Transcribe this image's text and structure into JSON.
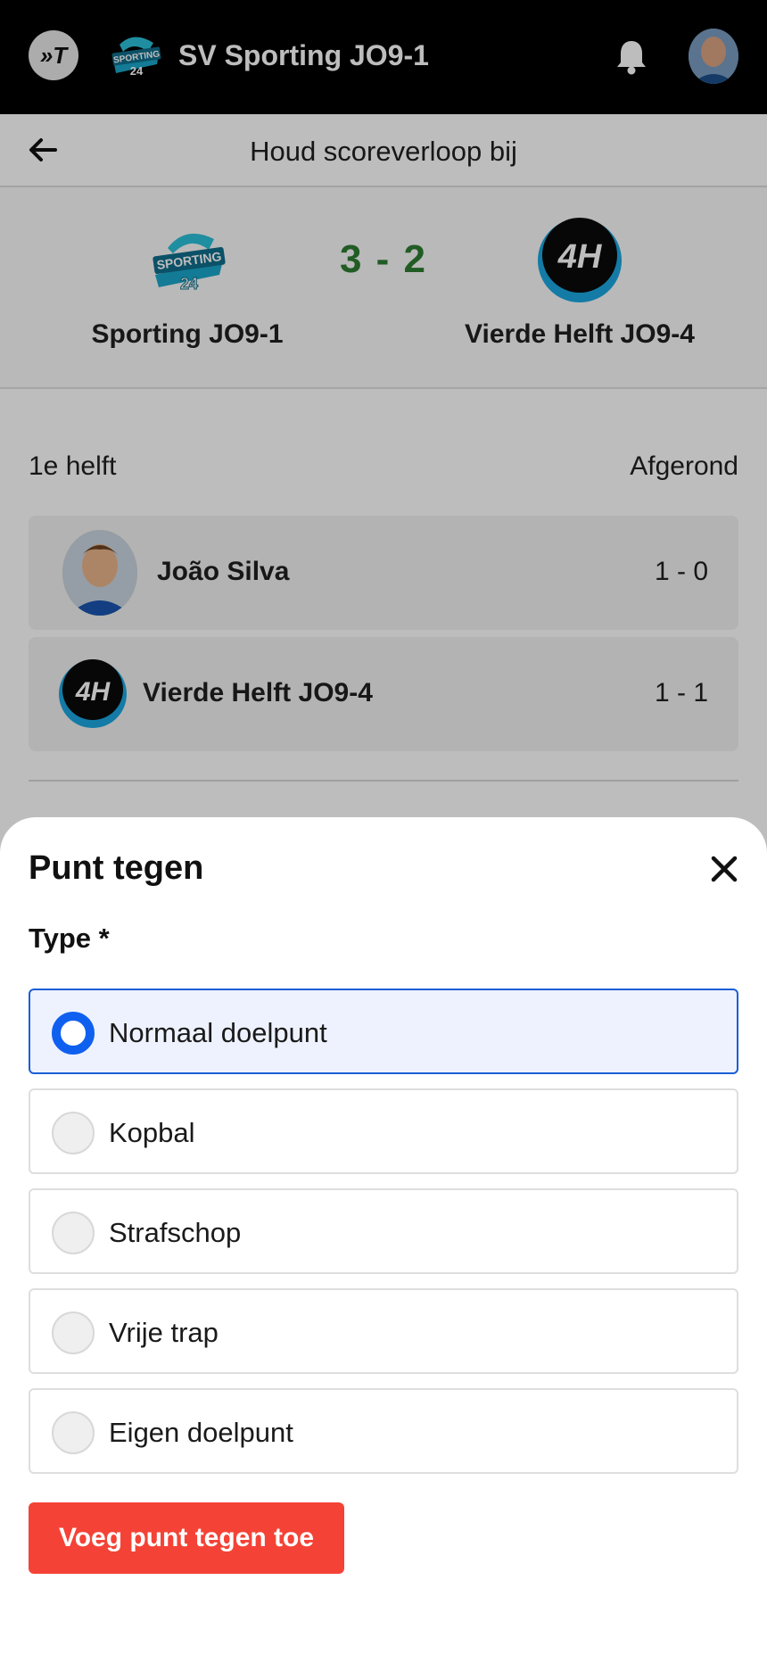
{
  "appbar": {
    "title": "SV Sporting JO9-1",
    "logo_text": "»T"
  },
  "subheader": {
    "title": "Houd scoreverloop bij"
  },
  "match": {
    "home_team": "Sporting JO9-1",
    "away_team": "Vierde Helft JO9-4",
    "score": "3 - 2",
    "home_badge_text": "SPORTING",
    "home_badge_number": "24",
    "away_badge_text": "4H",
    "score_color": "#2e7d32"
  },
  "half": {
    "label": "1e helft",
    "status": "Afgerond",
    "events": [
      {
        "name": "João Silva",
        "score": "1 - 0"
      },
      {
        "name": "Vierde Helft JO9-4",
        "score": "1 - 1"
      }
    ]
  },
  "sheet": {
    "title": "Punt tegen",
    "type_label": "Type *",
    "options": [
      {
        "label": "Normaal doelpunt",
        "selected": true
      },
      {
        "label": "Kopbal",
        "selected": false
      },
      {
        "label": "Strafschop",
        "selected": false
      },
      {
        "label": "Vrije trap",
        "selected": false
      },
      {
        "label": "Eigen doelpunt",
        "selected": false
      }
    ],
    "submit_label": "Voeg punt tegen toe",
    "accent_color": "#1060f0",
    "submit_color": "#f44336"
  }
}
